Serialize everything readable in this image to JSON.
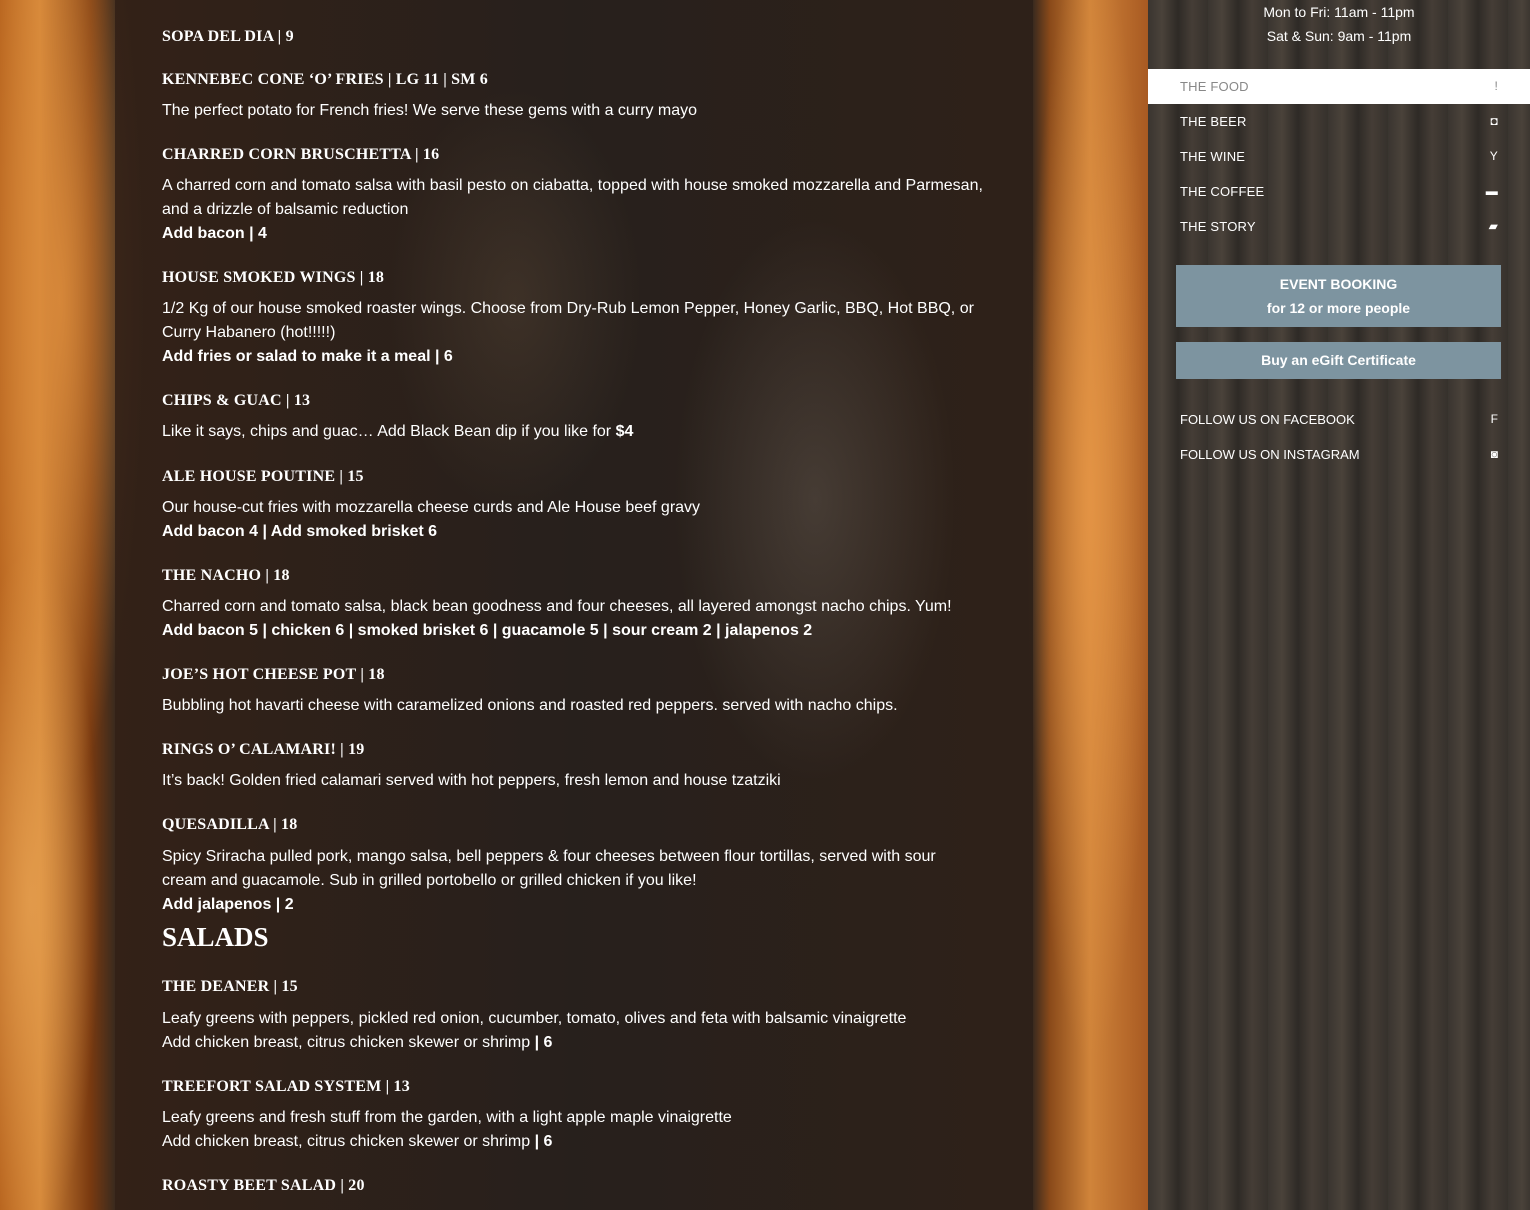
{
  "menu": {
    "items": [
      {
        "title": "SOPA DEL DIA | 9"
      },
      {
        "title": "KENNEBEC CONE ‘O’ FRIES | LG 11 | SM 6",
        "desc": "The perfect potato for French fries! We serve these gems with a curry mayo"
      },
      {
        "title": "CHARRED CORN BRUSCHETTA  | 16",
        "desc": "A charred corn and tomato salsa with basil pesto on ciabatta, topped with house smoked mozzarella and Parmesan, and a drizzle of balsamic reduction",
        "add": "Add bacon | 4"
      },
      {
        "title": "HOUSE SMOKED WINGS | 18",
        "desc": "1/2 Kg of our house smoked roaster wings. Choose from Dry-Rub Lemon Pepper, Honey Garlic, BBQ, Hot BBQ, or Curry Habanero (hot!!!!!)",
        "add": "Add fries or salad to make it a meal | 6"
      },
      {
        "title": "CHIPS & GUAC | 13",
        "desc": "Like it says, chips and guac…  Add Black Bean dip if you like for ",
        "desc_bold": "$4"
      },
      {
        "title": "ALE HOUSE POUTINE | 15",
        "desc": "Our house-cut fries with mozzarella cheese curds and Ale House beef gravy",
        "add": "Add bacon 4 | Add smoked brisket 6"
      },
      {
        "title": "THE NACHO | 18",
        "desc": "Charred corn and tomato salsa, black bean goodness and four cheeses, all layered amongst nacho chips. Yum!",
        "add": "Add bacon 5 | chicken 6 | smoked brisket 6 | guacamole 5 |  sour cream 2 | jalapenos 2"
      },
      {
        "title": "JOE’S HOT CHEESE POT | 18",
        "desc": "Bubbling hot havarti cheese with caramelized onions and roasted red peppers. served with nacho chips."
      },
      {
        "title": "RINGS O’ CALAMARI! | 19",
        "desc": "It’s back!  Golden fried calamari served with hot peppers, fresh lemon and house tzatziki"
      },
      {
        "title": "QUESADILLA | 18",
        "desc": "Spicy Sriracha pulled pork, mango salsa, bell peppers & four cheeses between flour tortillas, served with sour cream and guacamole.  Sub in grilled portobello or grilled chicken if you like!",
        "add": "Add jalapenos | 2"
      }
    ],
    "salads_title": "SALADS",
    "salads": [
      {
        "title": "THE DEANER | 15",
        "desc": "Leafy greens with peppers, pickled red onion, cucumber, tomato, olives and feta with balsamic vinaigrette",
        "desc2": "Add chicken breast, citrus chicken skewer or shrimp ",
        "desc2_bold": "| 6"
      },
      {
        "title": "TREEFORT SALAD SYSTEM | 13",
        "desc": "Leafy greens and fresh stuff from the garden, with a light apple maple vinaigrette",
        "desc2": "Add chicken breast, citrus chicken skewer or shrimp ",
        "desc2_bold": "| 6"
      },
      {
        "title": "ROASTY BEET SALAD | 20"
      }
    ]
  },
  "sidebar": {
    "hours": [
      "Mon to Fri: 11am - 11pm",
      "Sat & Sun: 9am - 11pm"
    ],
    "nav": [
      {
        "label": "THE FOOD",
        "icon": "fork-icon",
        "glyph": "ǃ"
      },
      {
        "label": "THE BEER",
        "icon": "beer-mug-icon",
        "glyph": "◘"
      },
      {
        "label": "THE WINE",
        "icon": "glass-icon",
        "glyph": "Y"
      },
      {
        "label": "THE COFFEE",
        "icon": "coffee-cup-icon",
        "glyph": "▬"
      },
      {
        "label": "THE STORY",
        "icon": "book-icon",
        "glyph": "▰"
      }
    ],
    "event_line1": "EVENT BOOKING",
    "event_line2": "for 12 or more people",
    "gift": "Buy an eGift Certificate",
    "social": [
      {
        "label": "FOLLOW US ON FACEBOOK",
        "icon": "facebook-icon",
        "glyph": "f"
      },
      {
        "label": "FOLLOW US ON INSTAGRAM",
        "icon": "instagram-icon",
        "glyph": "◙"
      }
    ],
    "accent": "#7d94a0"
  }
}
